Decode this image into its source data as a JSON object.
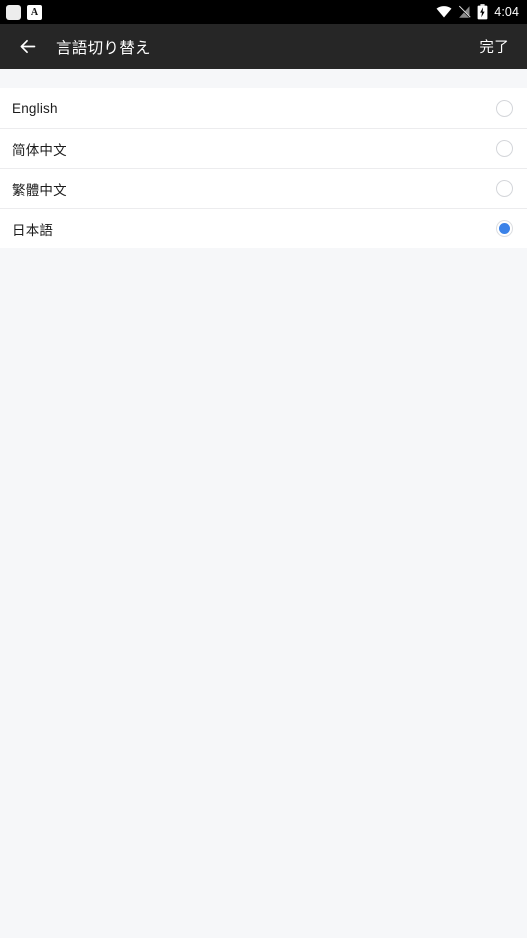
{
  "status_bar": {
    "left_icons": [
      {
        "name": "notification-square-icon",
        "glyph": ""
      },
      {
        "name": "ime-indicator-icon",
        "glyph": "A"
      }
    ],
    "right_icons": [
      {
        "name": "wifi-icon"
      },
      {
        "name": "signal-off-icon"
      },
      {
        "name": "battery-charging-icon"
      }
    ],
    "time": "4:04",
    "background_color": "#000000"
  },
  "toolbar": {
    "back_icon": "arrow-left-icon",
    "title": "言語切り替え",
    "action_label": "完了",
    "background_color": "#262626",
    "text_color": "#ffffff"
  },
  "language_list": {
    "selected_index": 3,
    "accent_color": "#3b82e8",
    "items": [
      {
        "label": "English",
        "selected": false
      },
      {
        "label": "简体中文",
        "selected": false
      },
      {
        "label": "繁體中文",
        "selected": false
      },
      {
        "label": "日本語",
        "selected": true
      }
    ]
  },
  "page": {
    "background_color": "#f6f7f9"
  }
}
